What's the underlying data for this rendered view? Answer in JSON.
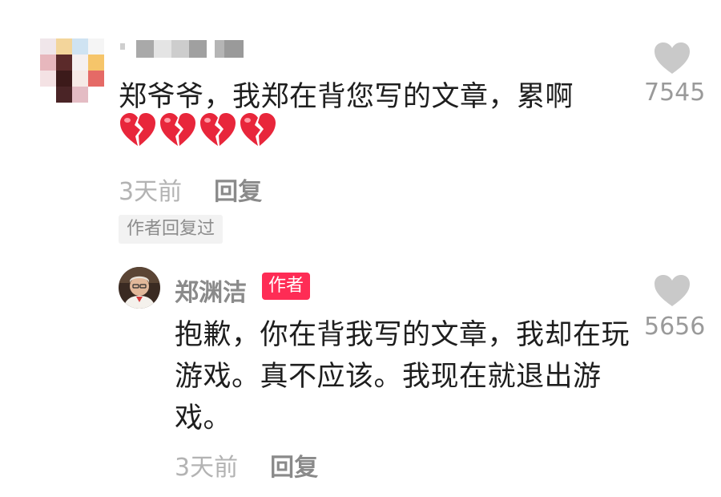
{
  "comment": {
    "text": "郑爷爷，我郑在背您写的文章，累啊",
    "emoji": [
      "broken-heart",
      "broken-heart",
      "broken-heart",
      "broken-heart"
    ],
    "time": "3天前",
    "reply_label": "回复",
    "author_replied_badge": "作者回复过",
    "like_count": "7545"
  },
  "reply": {
    "username": "郑渊洁",
    "author_badge": "作者",
    "text": "抱歉，你在背我写的文章，我却在玩游戏。真不应该。我现在就退出游戏。",
    "time": "3天前",
    "reply_label": "回复",
    "like_count": "5656"
  },
  "colors": {
    "author_badge": "#fe2c55",
    "like_heart": "#c9c9c9",
    "broken_heart": "#e8263b"
  }
}
